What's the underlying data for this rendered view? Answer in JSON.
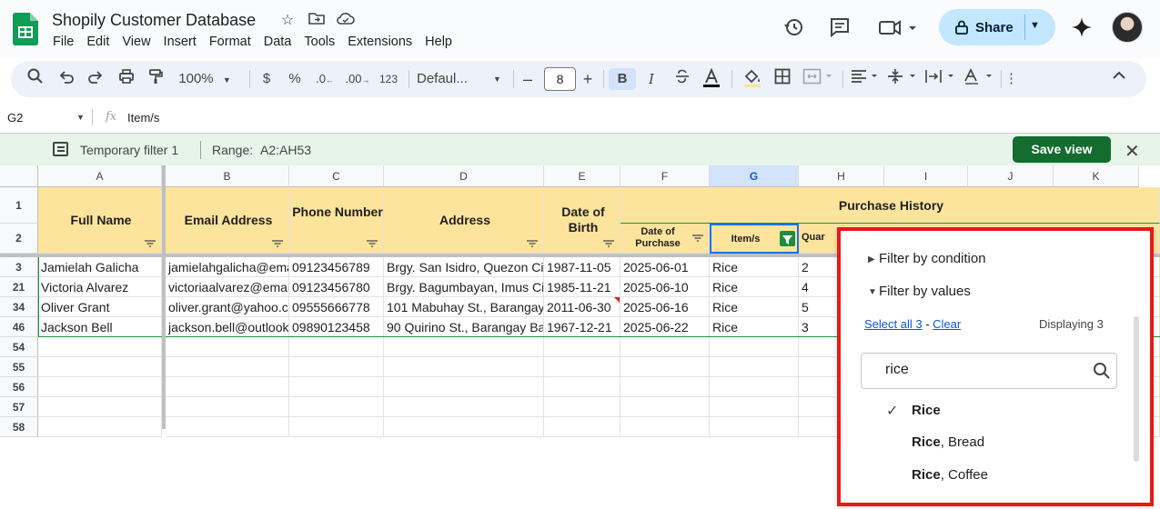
{
  "app": {
    "doc_title": "Shopily Customer Database",
    "menu": [
      "File",
      "Edit",
      "View",
      "Insert",
      "Format",
      "Data",
      "Tools",
      "Extensions",
      "Help"
    ],
    "share_label": "Share"
  },
  "toolbar": {
    "zoom": "100%",
    "currency": "$",
    "percent": "%",
    "dec_less": ".0",
    "dec_more": ".00",
    "number_format": "123",
    "font": "Defaul...",
    "font_size": "8",
    "bold": "B",
    "italic": "I"
  },
  "formula_bar": {
    "cell_ref": "G2",
    "fx": "fx",
    "value": "Item/s"
  },
  "filter_bar": {
    "name": "Temporary filter 1",
    "range_label": "Range:",
    "range_value": "A2:AH53",
    "save_label": "Save view"
  },
  "grid": {
    "columns": [
      "A",
      "B",
      "C",
      "D",
      "E",
      "F",
      "G",
      "H",
      "I",
      "J",
      "K"
    ],
    "selected_column": "G",
    "header_rows": [
      "1",
      "2"
    ],
    "headers": {
      "full_name": "Full Name",
      "email": "Email Address",
      "phone": "Phone Number",
      "address": "Address",
      "dob": "Date of Birth",
      "purchase_history": "Purchase History",
      "date_of_purchase": "Date of Purchase",
      "items": "Item/s",
      "quantity_partial": "Quar"
    },
    "rows": [
      {
        "row": "3",
        "cells": [
          "Jamielah Galicha",
          "jamielahgalicha@ema",
          "09123456789",
          "Brgy. San Isidro, Quezon Cit",
          "1987-11-05",
          "2025-06-01",
          "Rice",
          "2"
        ]
      },
      {
        "row": "21",
        "cells": [
          "Victoria Alvarez",
          "victoriaalvarez@emai",
          "09123456780",
          "Brgy. Bagumbayan, Imus Ci",
          "1985-11-21",
          "2025-06-10",
          "Rice",
          "4"
        ]
      },
      {
        "row": "34",
        "cells": [
          "Oliver Grant",
          "oliver.grant@yahoo.cc",
          "09555666778",
          "101 Mabuhay St., Barangay",
          "2011-06-30",
          "2025-06-16",
          "Rice",
          "5"
        ]
      },
      {
        "row": "46",
        "cells": [
          "Jackson Bell",
          "jackson.bell@outlook",
          "09890123458",
          "90 Quirino St., Barangay Ba",
          "1967-12-21",
          "2025-06-22",
          "Rice",
          "3"
        ]
      }
    ],
    "empty_rows": [
      "54",
      "55",
      "56",
      "57",
      "58"
    ]
  },
  "filter_panel": {
    "by_condition": "Filter by condition",
    "by_values": "Filter by values",
    "select_all": "Select all 3",
    "dash": " - ",
    "clear": "Clear",
    "displaying": "Displaying 3",
    "search_value": "rice",
    "items": [
      {
        "match": "Rice",
        "rest": "",
        "checked": true
      },
      {
        "match": "Rice",
        "rest": ", Bread",
        "checked": false
      },
      {
        "match": "Rice",
        "rest": ", Coffee",
        "checked": false
      }
    ]
  },
  "colors": {
    "header_fill": "#fde49c",
    "filter_bar_bg": "#e6f4ea",
    "save_button": "#146c2e",
    "share_bg": "#c2e7ff",
    "highlight_border": "#e21b1b",
    "link": "#0b57d0"
  }
}
